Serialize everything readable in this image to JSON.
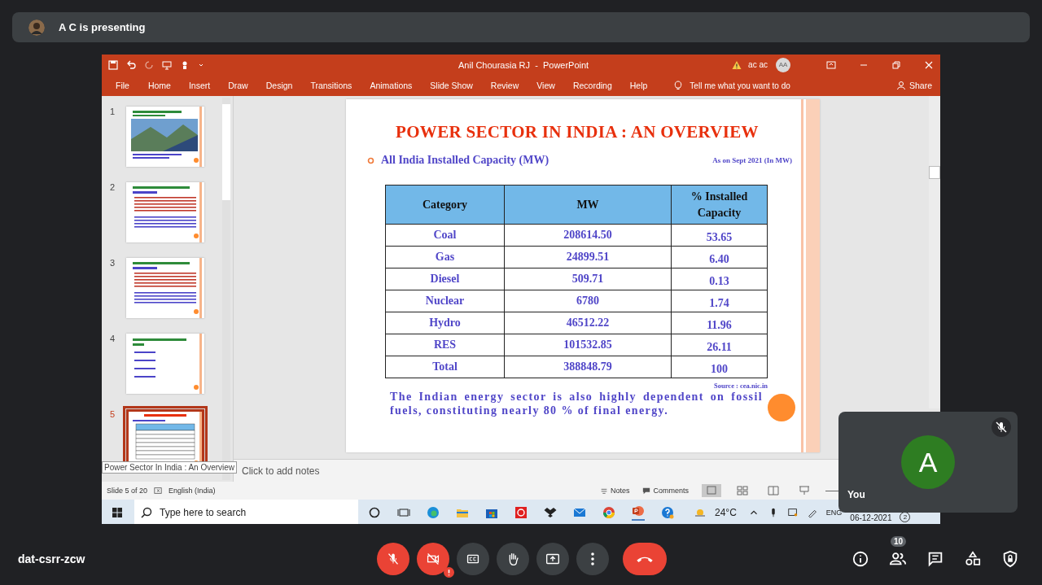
{
  "presenter_banner": {
    "text": "A C is presenting"
  },
  "powerpoint": {
    "title": "Anil Chourasia RJ  -  PowerPoint",
    "account": {
      "name": "ac ac",
      "initials": "AA"
    },
    "ribbon_tabs": [
      "File",
      "Home",
      "Insert",
      "Draw",
      "Design",
      "Transitions",
      "Animations",
      "Slide Show",
      "Review",
      "View",
      "Recording",
      "Help"
    ],
    "tell_me": "Tell me what you want to do",
    "share": "Share",
    "thumbnails": [
      {
        "number": "1",
        "kind": "photo",
        "selected": false
      },
      {
        "number": "2",
        "kind": "text",
        "selected": false
      },
      {
        "number": "3",
        "kind": "text",
        "selected": false
      },
      {
        "number": "4",
        "kind": "list",
        "selected": false
      },
      {
        "number": "5",
        "kind": "table",
        "selected": true
      }
    ],
    "tooltip": "Power Sector In India : An Overview",
    "slide": {
      "title": "POWER SECTOR IN INDIA : AN OVERVIEW",
      "bullet": "All India Installed Capacity (MW)",
      "as_on": "As on Sept 2021 (In MW)",
      "table": {
        "columns": [
          "Category",
          "MW",
          "% Installed Capacity"
        ],
        "rows": [
          {
            "category": "Coal",
            "mw": "208614.50",
            "share": "53.65"
          },
          {
            "category": "Gas",
            "mw": "24899.51",
            "share": "6.40"
          },
          {
            "category": "Diesel",
            "mw": "509.71",
            "share": "0.13"
          },
          {
            "category": "Nuclear",
            "mw": "6780",
            "share": "1.74"
          },
          {
            "category": "Hydro",
            "mw": "46512.22",
            "share": "11.96"
          },
          {
            "category": "RES",
            "mw": "101532.85",
            "share": "26.11"
          },
          {
            "category": "Total",
            "mw": "388848.79",
            "share": "100"
          }
        ]
      },
      "source": "Source : cea.nic.in",
      "summary": "The Indian energy sector is also highly dependent on fossil fuels, constituting nearly 80 % of final energy."
    },
    "notes_placeholder": "Click to add notes",
    "status_bar": {
      "slide_position": "Slide 5 of 20",
      "language": "English (India)",
      "notes": "Notes",
      "comments": "Comments"
    }
  },
  "taskbar": {
    "search_placeholder": "Type here to search",
    "weather": "24°C",
    "language": "ENG",
    "date": "06-12-2021",
    "notification_count": "2"
  },
  "self_tile": {
    "initial": "A",
    "label": "You",
    "muted": true
  },
  "meeting": {
    "code": "dat-csrr-zcw",
    "participant_count": "10",
    "mic_on": false,
    "camera_on": false
  }
}
